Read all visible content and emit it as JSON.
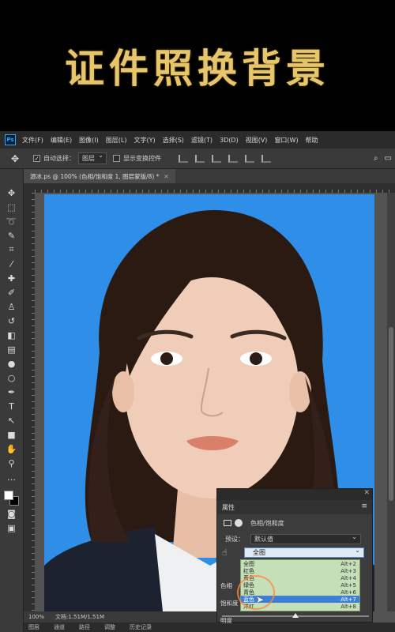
{
  "headline": "证件照换背景",
  "app": {
    "logo": "Ps",
    "menu": [
      "文件(F)",
      "编辑(E)",
      "图像(I)",
      "图层(L)",
      "文字(Y)",
      "选择(S)",
      "滤镜(T)",
      "3D(D)",
      "视图(V)",
      "窗口(W)",
      "帮助"
    ],
    "options": {
      "auto_select_label": "自动选择：",
      "auto_select_value": "图层",
      "show_transform_label": "显示变换控件"
    },
    "document_tab": "源冰.ps @ 100% (色相/饱和度 1, 图层蒙版/8) *",
    "tools": [
      "move-icon",
      "marquee-icon",
      "lasso-icon",
      "quick-select-icon",
      "crop-icon",
      "eyedropper-icon",
      "healing-icon",
      "brush-icon",
      "stamp-icon",
      "history-brush-icon",
      "eraser-icon",
      "gradient-icon",
      "blur-icon",
      "dodge-icon",
      "pen-icon",
      "type-icon",
      "path-select-icon",
      "shape-icon",
      "hand-icon",
      "zoom-icon",
      "more-icon"
    ],
    "status": {
      "zoom": "100%",
      "doc": "文档:1.51M/1.51M"
    },
    "bottom_tabs": [
      "图层",
      "通道",
      "路径",
      "调整",
      "历史记录"
    ],
    "colors": {
      "photo_bg": "#2f8fe8",
      "headline": "#e7c56b",
      "selection": "#3d7fd6",
      "dropdown_bg": "#c5e0b8"
    }
  },
  "properties": {
    "panel_title": "属性",
    "layer_type": "色相/饱和度",
    "preset_label": "预设：",
    "preset_value": "默认值",
    "channel_value": "全图",
    "labels": {
      "hue": "色相",
      "saturation": "饱和度",
      "lightness": "明度"
    },
    "dropdown": [
      {
        "label": "全图",
        "shortcut": "Alt+2"
      },
      {
        "label": "红色",
        "shortcut": "Alt+3"
      },
      {
        "label": "黄色",
        "shortcut": "Alt+4"
      },
      {
        "label": "绿色",
        "shortcut": "Alt+5"
      },
      {
        "label": "青色",
        "shortcut": "Alt+6"
      },
      {
        "label": "蓝色",
        "shortcut": "Alt+7"
      },
      {
        "label": "洋红",
        "shortcut": "Alt+8"
      }
    ],
    "selected_index": 5
  }
}
